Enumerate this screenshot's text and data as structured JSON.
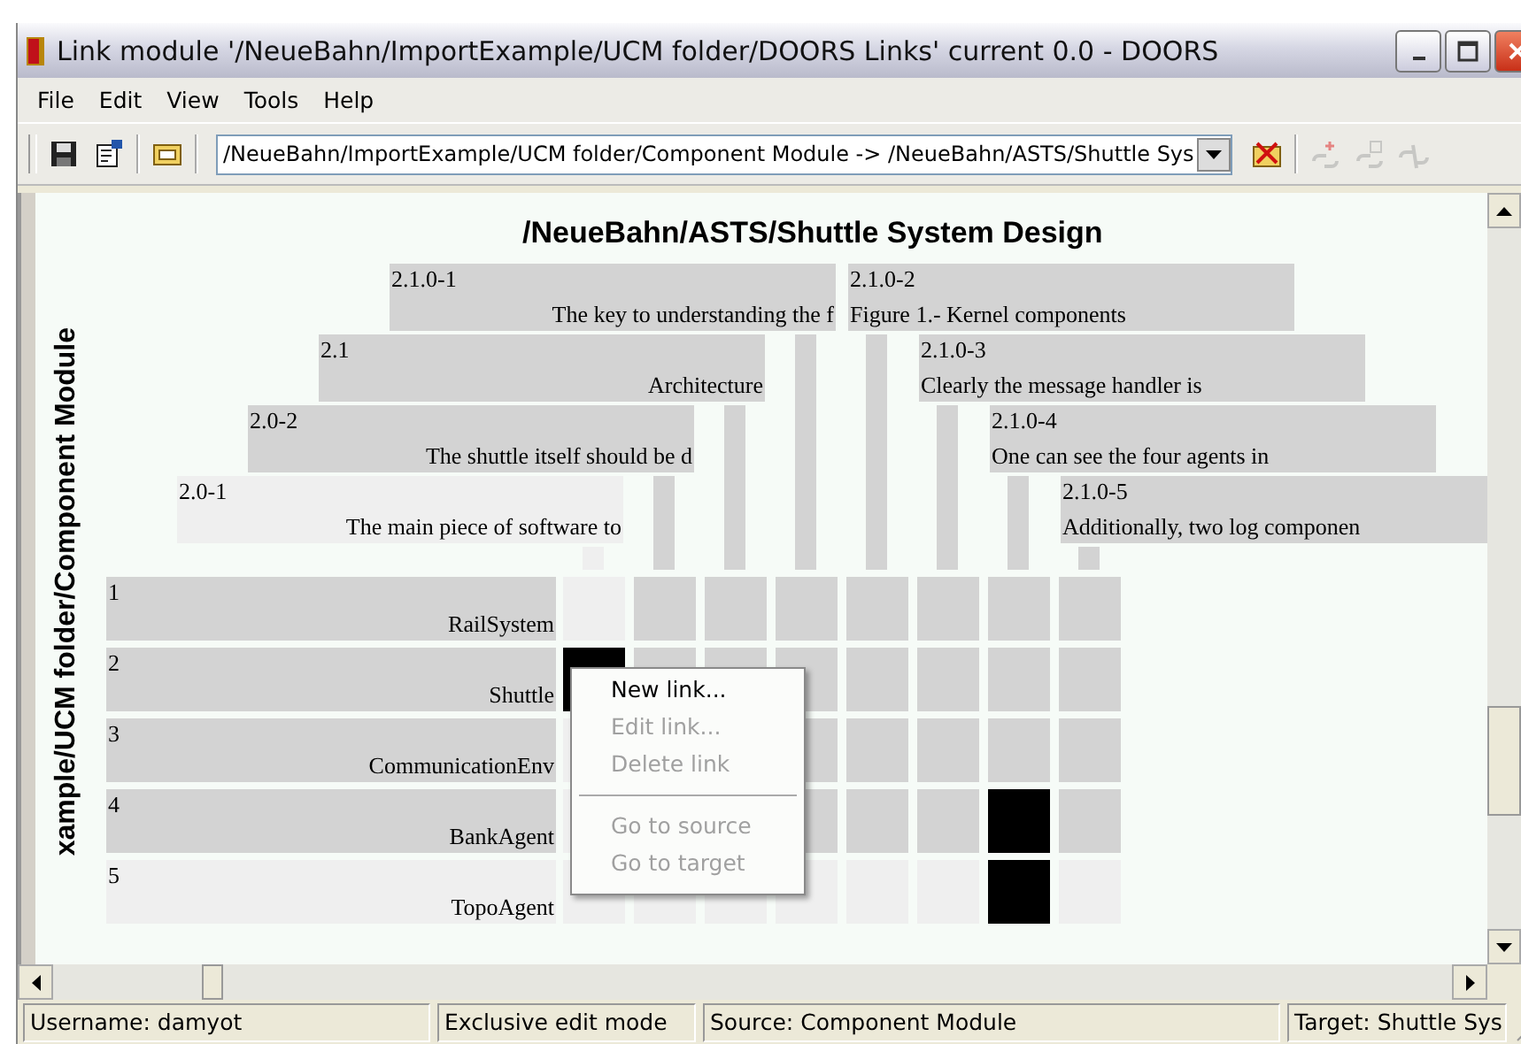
{
  "window": {
    "title": "Link module '/NeueBahn/ImportExample/UCM folder/DOORS Links' current 0.0 - DOORS"
  },
  "menu": [
    "File",
    "Edit",
    "View",
    "Tools",
    "Help"
  ],
  "toolbar": {
    "buttons": [
      {
        "kind": "save",
        "disabled": false
      },
      {
        "kind": "properties",
        "disabled": false
      },
      {
        "kind": "open-module",
        "disabled": false
      }
    ],
    "path_selector": {
      "value": "/NeueBahn/ImportExample/UCM folder/Component Module -> /NeueBahn/ASTS/Shuttle Sys"
    },
    "tools": [
      {
        "kind": "delete-module",
        "disabled": false
      },
      {
        "kind": "new-link",
        "disabled": true
      },
      {
        "kind": "link-properties",
        "disabled": true
      },
      {
        "kind": "break-link",
        "disabled": true
      }
    ]
  },
  "matrix": {
    "title": "/NeueBahn/ASTS/Shuttle System Design",
    "row_axis_label": "xample/UCM folder/Component Module",
    "columns": [
      {
        "number": "2.0-1",
        "text": "The main piece of software to",
        "dimmed": true
      },
      {
        "number": "2.0-2",
        "text": "The shuttle itself should be d",
        "dimmed": false
      },
      {
        "number": "2.1",
        "text": "Architecture",
        "dimmed": false
      },
      {
        "number": "2.1.0-1",
        "text": "The key to understanding the f",
        "dimmed": false
      },
      {
        "number": "2.1.0-2",
        "text": "Figure 1.- Kernel components",
        "dimmed": false
      },
      {
        "number": "2.1.0-3",
        "text": "Clearly the message handler is",
        "dimmed": false
      },
      {
        "number": "2.1.0-4",
        "text": "One can see the four agents in",
        "dimmed": false
      },
      {
        "number": "2.1.0-5",
        "text": "Additionally, two log componen",
        "dimmed": false
      }
    ],
    "rows": [
      {
        "number": "1",
        "name": "RailSystem",
        "dimmed": false,
        "cells": [
          {
            "kind": "cell",
            "linked": false
          },
          {
            "kind": "cell",
            "linked": false
          },
          {
            "kind": "cell",
            "linked": false
          },
          {
            "kind": "cell",
            "linked": false
          },
          {
            "kind": "cell",
            "linked": false
          },
          {
            "kind": "cell",
            "linked": false
          },
          {
            "kind": "cell",
            "linked": false
          },
          {
            "kind": "cell",
            "linked": false
          }
        ]
      },
      {
        "number": "2",
        "name": "Shuttle",
        "dimmed": false,
        "cells": [
          {
            "kind": "cell",
            "linked": true
          },
          {
            "kind": "cell",
            "linked": false
          },
          {
            "kind": "cell",
            "linked": false
          },
          {
            "kind": "cell",
            "linked": false
          },
          {
            "kind": "cell",
            "linked": false
          },
          {
            "kind": "cell",
            "linked": false
          },
          {
            "kind": "cell",
            "linked": false
          },
          {
            "kind": "cell",
            "linked": false
          }
        ]
      },
      {
        "number": "3",
        "name": "CommunicationEnv",
        "dimmed": false,
        "cells": [
          {
            "kind": "cell",
            "linked": false
          },
          {
            "kind": "covered"
          },
          {
            "kind": "covered"
          },
          {
            "kind": "cell",
            "linked": false
          },
          {
            "kind": "cell",
            "linked": false
          },
          {
            "kind": "cell",
            "linked": false
          },
          {
            "kind": "cell",
            "linked": false
          },
          {
            "kind": "cell",
            "linked": false
          }
        ]
      },
      {
        "number": "4",
        "name": "BankAgent",
        "dimmed": false,
        "cells": [
          {
            "kind": "cell",
            "linked": false
          },
          {
            "kind": "covered"
          },
          {
            "kind": "covered"
          },
          {
            "kind": "cell",
            "linked": false
          },
          {
            "kind": "cell",
            "linked": false
          },
          {
            "kind": "cell",
            "linked": false
          },
          {
            "kind": "cell",
            "linked": true
          },
          {
            "kind": "cell",
            "linked": false
          }
        ]
      },
      {
        "number": "5",
        "name": "TopoAgent",
        "dimmed": true,
        "cells": [
          {
            "kind": "cell",
            "linked": false
          },
          {
            "kind": "cell",
            "linked": false
          },
          {
            "kind": "cell",
            "linked": false
          },
          {
            "kind": "cell",
            "linked": false
          },
          {
            "kind": "cell",
            "linked": false
          },
          {
            "kind": "cell",
            "linked": false
          },
          {
            "kind": "cell",
            "linked": true
          },
          {
            "kind": "cell",
            "linked": false
          }
        ]
      }
    ]
  },
  "context_menu": {
    "items": [
      {
        "kind": "item",
        "label": "New link...",
        "disabled": false
      },
      {
        "kind": "item",
        "label": "Edit link...",
        "disabled": true
      },
      {
        "kind": "item",
        "label": "Delete link",
        "disabled": true
      },
      {
        "kind": "separator"
      },
      {
        "kind": "item",
        "label": "Go to source",
        "disabled": true
      },
      {
        "kind": "item",
        "label": "Go to target",
        "disabled": true
      }
    ]
  },
  "status_bar": [
    "Username: damyot",
    "Exclusive edit mode",
    "Source: Component Module",
    "Target: Shuttle Sys"
  ]
}
